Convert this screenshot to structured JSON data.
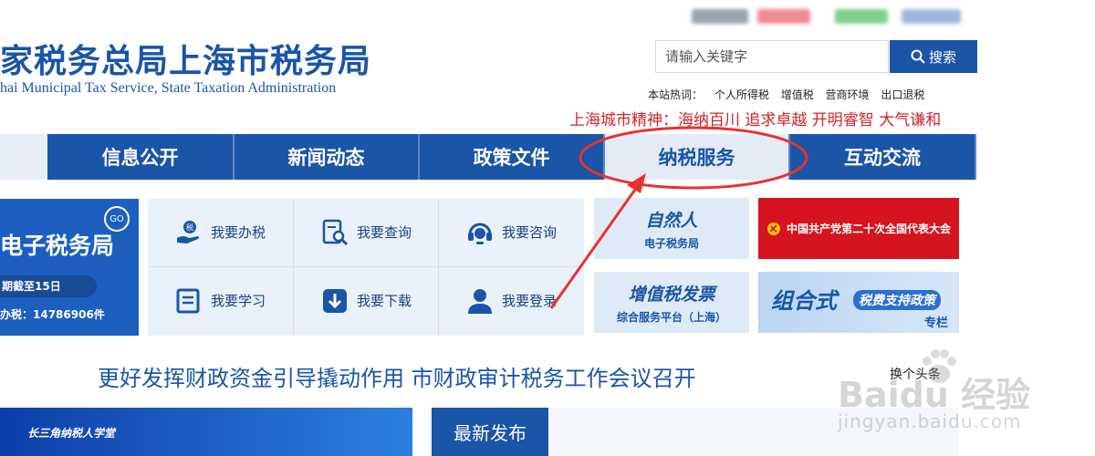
{
  "header": {
    "title": "家税务总局上海市税务局",
    "subtitle": "hai Municipal Tax Service, State Taxation Administration"
  },
  "search": {
    "placeholder": "请输入关键字",
    "button_label": "搜索"
  },
  "hot_keywords": {
    "label": "本站热词：",
    "items": [
      "个人所得税",
      "增值税",
      "营商环境",
      "出口退税"
    ]
  },
  "slogan": "上海城市精神：海纳百川 追求卓越 开明睿智 大气谦和",
  "nav": {
    "items": [
      {
        "label": "信息公开"
      },
      {
        "label": "新闻动态"
      },
      {
        "label": "政策文件"
      },
      {
        "label": "纳税服务"
      },
      {
        "label": "互动交流"
      }
    ]
  },
  "etax": {
    "title": "电子税务局",
    "go": "GO",
    "deadline": "期截至15日",
    "count": "办税：14786906件"
  },
  "services": [
    {
      "label": "我要办税",
      "icon": "hand-coin-icon"
    },
    {
      "label": "我要查询",
      "icon": "search-doc-icon"
    },
    {
      "label": "我要咨询",
      "icon": "headset-icon"
    },
    {
      "label": "我要学习",
      "icon": "book-icon"
    },
    {
      "label": "我要下载",
      "icon": "download-icon"
    },
    {
      "label": "我要登录",
      "icon": "user-icon"
    }
  ],
  "promos": {
    "natural_person": {
      "big": "自然人",
      "small": "电子税务局"
    },
    "vat_invoice": {
      "big": "增值税发票",
      "small": "综合服务平台（上海）"
    },
    "party_congress": "中国共产党第二十次全国代表大会",
    "policy": {
      "big": "组合式",
      "middle": "税费支持政策",
      "small": "专栏"
    }
  },
  "headline": "更好发挥财政资金引导撬动作用 市财政审计税务工作会议召开",
  "switch_link": "换个头条",
  "bottom_banner": "长三角纳税人学堂",
  "latest_label": "最新发布",
  "watermark": {
    "brand": "Baidu 经验",
    "url": "jingyan.baidu.com"
  },
  "colors": {
    "brand_blue": "#1a55a8",
    "slogan_red": "#d0242a",
    "annotation_red": "#e8322f"
  }
}
